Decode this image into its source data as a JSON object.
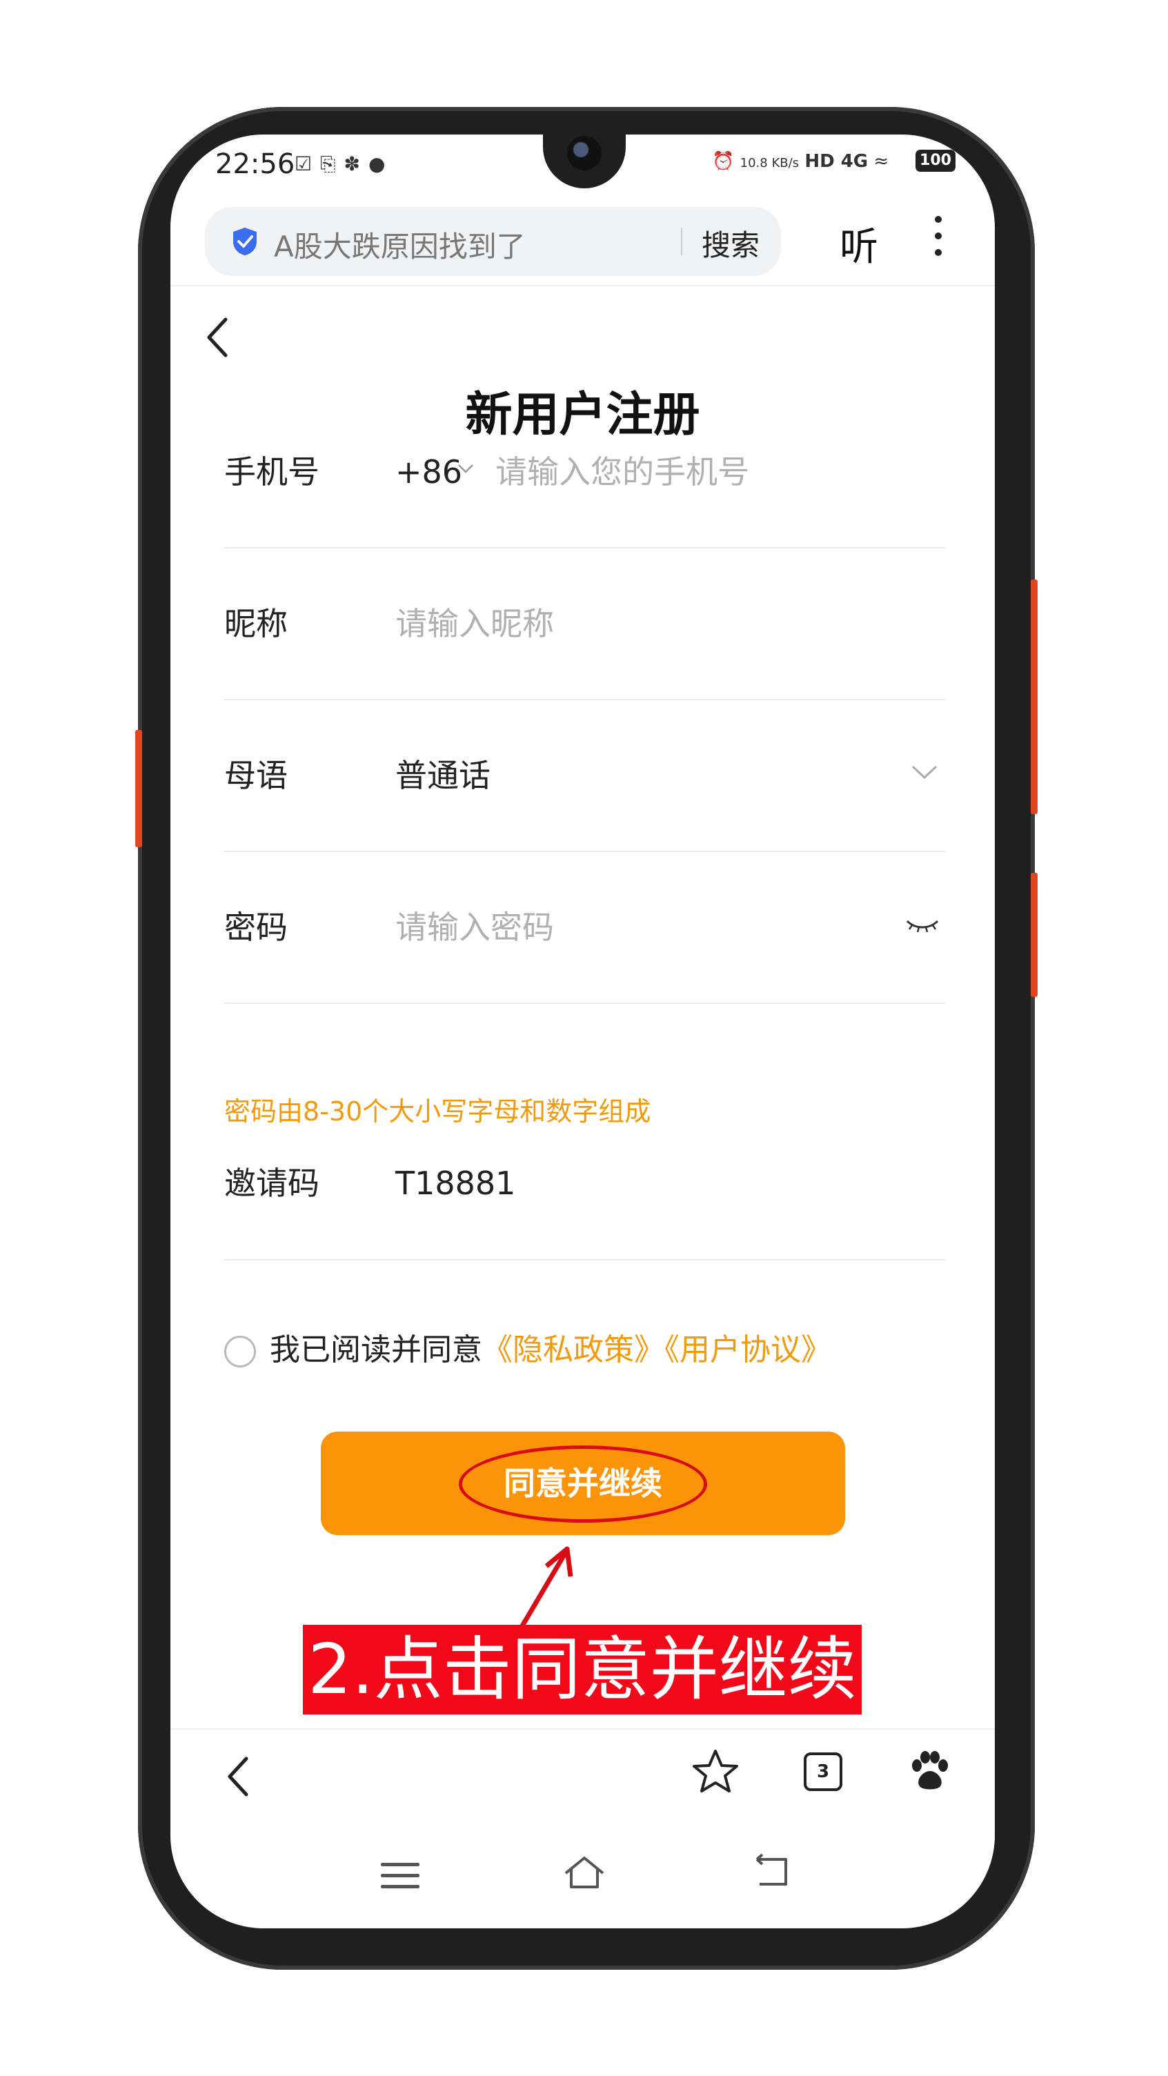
{
  "status_bar": {
    "time": "22:56",
    "net_speed": "10.8 KB/s",
    "network": "HD 4G",
    "battery": "100"
  },
  "browser": {
    "search_text": "A股大跌原因找到了",
    "search_button": "搜索",
    "listen_button": "听"
  },
  "page": {
    "back_symbol": "<",
    "title": "新用户注册"
  },
  "form": {
    "phone": {
      "label": "手机号",
      "country_code": "+86",
      "placeholder": "请输入您的手机号"
    },
    "nickname": {
      "label": "昵称",
      "placeholder": "请输入昵称"
    },
    "language": {
      "label": "母语",
      "value": "普通话"
    },
    "password": {
      "label": "密码",
      "placeholder": "请输入密码"
    },
    "password_hint": "密码由8-30个大小写字母和数字组成",
    "invite": {
      "label": "邀请码",
      "value": "T18881"
    }
  },
  "agreement": {
    "text": "我已阅读并同意",
    "privacy_link": "《隐私政策》",
    "user_link": "《用户协议》"
  },
  "cta_label": "同意并继续",
  "annotation_text": "2.点击同意并继续",
  "bottom_nav": {
    "tabs_count": "3"
  },
  "colors": {
    "accent": "#fc940a",
    "hint": "#f29a0e",
    "annotation_red": "#f1091a"
  }
}
